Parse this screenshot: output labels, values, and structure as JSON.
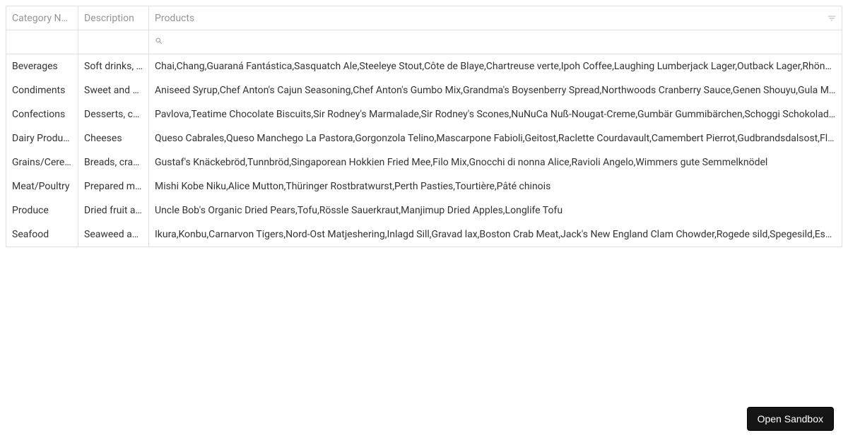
{
  "grid": {
    "headers": {
      "category_name": "Category Name",
      "description": "Description",
      "products": "Products"
    },
    "rows": [
      {
        "category_name": "Beverages",
        "description": "Soft drinks, coffees, teas, beers, and ales",
        "products": "Chai,Chang,Guaraná Fantástica,Sasquatch Ale,Steeleye Stout,Côte de Blaye,Chartreuse verte,Ipoh Coffee,Laughing Lumberjack Lager,Outback Lager,Rhönbräu Klosterbier,Lakkalikööri"
      },
      {
        "category_name": "Condiments",
        "description": "Sweet and savory sauces, relishes, spreads, and seasonings",
        "products": "Aniseed Syrup,Chef Anton's Cajun Seasoning,Chef Anton's Gumbo Mix,Grandma's Boysenberry Spread,Northwoods Cranberry Sauce,Genen Shouyu,Gula Malacca,Sirop d'érable"
      },
      {
        "category_name": "Confections",
        "description": "Desserts, candies, and sweet breads",
        "products": "Pavlova,Teatime Chocolate Biscuits,Sir Rodney's Marmalade,Sir Rodney's Scones,NuNuCa Nuß-Nougat-Creme,Gumbär Gummibärchen,Schoggi Schokolade,Zaanse koeken"
      },
      {
        "category_name": "Dairy Products",
        "description": "Cheeses",
        "products": "Queso Cabrales,Queso Manchego La Pastora,Gorgonzola Telino,Mascarpone Fabioli,Geitost,Raclette Courdavault,Camembert Pierrot,Gudbrandsdalsost,Flotemysost,Mozzarella di Giovanni"
      },
      {
        "category_name": "Grains/Cereals",
        "description": "Breads, crackers, pasta, and cereal",
        "products": "Gustaf's Knäckebröd,Tunnbröd,Singaporean Hokkien Fried Mee,Filo Mix,Gnocchi di nonna Alice,Ravioli Angelo,Wimmers gute Semmelknödel"
      },
      {
        "category_name": "Meat/Poultry",
        "description": "Prepared meats",
        "products": "Mishi Kobe Niku,Alice Mutton,Thüringer Rostbratwurst,Perth Pasties,Tourtière,Pâté chinois"
      },
      {
        "category_name": "Produce",
        "description": "Dried fruit and bean curd",
        "products": "Uncle Bob's Organic Dried Pears,Tofu,Rössle Sauerkraut,Manjimup Dried Apples,Longlife Tofu"
      },
      {
        "category_name": "Seafood",
        "description": "Seaweed and fish",
        "products": "Ikura,Konbu,Carnarvon Tigers,Nord-Ost Matjeshering,Inlagd Sill,Gravad lax,Boston Crab Meat,Jack's New England Clam Chowder,Rogede sild,Spegesild,Escargots de Bourgogne"
      }
    ]
  },
  "sandbox_button_label": "Open Sandbox"
}
